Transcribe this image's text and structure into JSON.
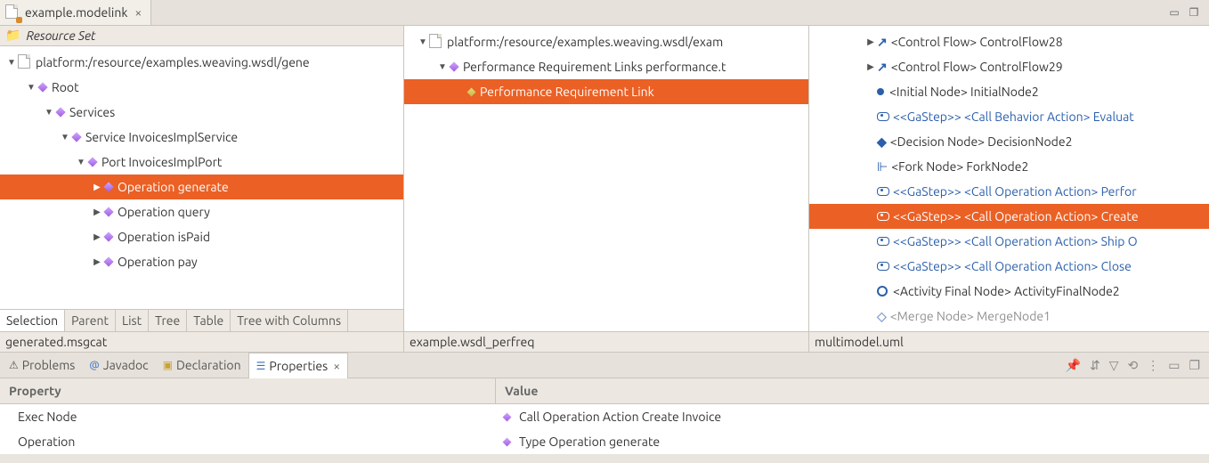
{
  "editor": {
    "file_tab": "example.modelink"
  },
  "left": {
    "header": "Resource Set",
    "root_path": "platform:/resource/examples.weaving.wsdl/gene",
    "nodes": {
      "root": "Root",
      "services": "Services",
      "service": "Service InvoicesImplService",
      "port": "Port InvoicesImplPort",
      "op_generate": "Operation generate",
      "op_query": "Operation query",
      "op_isPaid": "Operation isPaid",
      "op_pay": "Operation pay"
    },
    "bottom_tabs": [
      "Selection",
      "Parent",
      "List",
      "Tree",
      "Table",
      "Tree with Columns"
    ],
    "file_label": "generated.msgcat"
  },
  "mid": {
    "root_path": "platform:/resource/examples.weaving.wsdl/exam",
    "links_container": "Performance Requirement Links performance.t",
    "link_item": "Performance Requirement Link",
    "file_label": "example.wsdl_perfreq"
  },
  "right": {
    "items": {
      "cf28": "<Control Flow> ControlFlow28",
      "cf29": "<Control Flow> ControlFlow29",
      "init": "<Initial Node> InitialNode2",
      "eval": "<<GaStep>> <Call Behavior Action> Evaluat",
      "dec": "<Decision Node> DecisionNode2",
      "fork": "<Fork Node> ForkNode2",
      "perf": "<<GaStep>> <Call Operation Action> Perfor",
      "create": "<<GaStep>> <Call Operation Action> Create",
      "ship": "<<GaStep>> <Call Operation Action> Ship O",
      "close": "<<GaStep>> <Call Operation Action> Close",
      "final": "<Activity Final Node> ActivityFinalNode2",
      "merge": "<Merge Node> MergeNode1"
    },
    "file_label": "multimodel.uml"
  },
  "props": {
    "tabs": {
      "problems": "Problems",
      "javadoc": "Javadoc",
      "declaration": "Declaration",
      "properties": "Properties"
    },
    "header": {
      "property": "Property",
      "value": "Value"
    },
    "rows": {
      "exec": {
        "name": "Exec Node",
        "value": "Call Operation Action Create Invoice"
      },
      "op": {
        "name": "Operation",
        "value": "Type Operation generate"
      }
    }
  }
}
